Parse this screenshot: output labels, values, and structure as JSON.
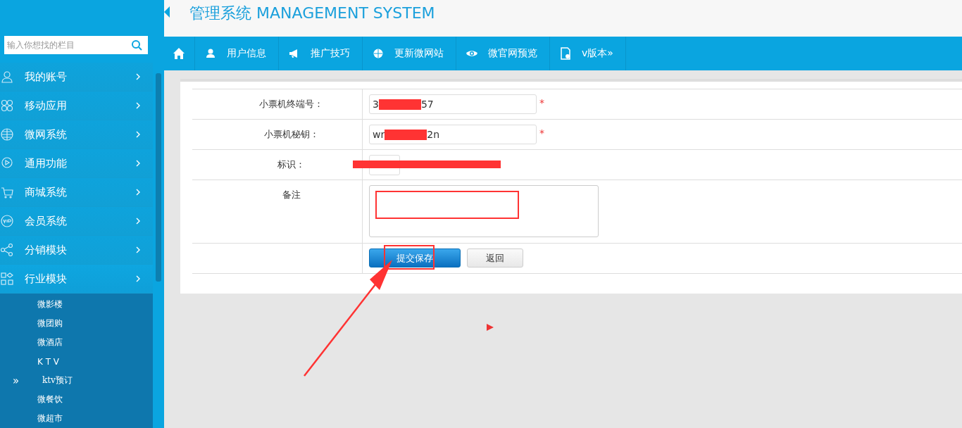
{
  "header": {
    "title": "管理系统 MANAGEMENT SYSTEM"
  },
  "search": {
    "placeholder": "输入你想找的栏目"
  },
  "sidebar": {
    "items": [
      {
        "label": "我的账号"
      },
      {
        "label": "移动应用"
      },
      {
        "label": "微网系统"
      },
      {
        "label": "通用功能"
      },
      {
        "label": "商城系统"
      },
      {
        "label": "会员系统"
      },
      {
        "label": "分销模块"
      },
      {
        "label": "行业模块",
        "expanded": true,
        "children": [
          {
            "label": "微影楼",
            "selected": false
          },
          {
            "label": "微团购",
            "selected": false
          },
          {
            "label": "微酒店",
            "selected": false
          },
          {
            "label": "K T V",
            "selected": false
          },
          {
            "label": "ktv预订",
            "selected": true,
            "marker": "»"
          },
          {
            "label": "微餐饮",
            "selected": false
          },
          {
            "label": "微超市",
            "selected": false
          }
        ]
      }
    ]
  },
  "nav": [
    {
      "kind": "icon"
    },
    {
      "kind": "link",
      "label": "用户信息"
    },
    {
      "kind": "link",
      "label": "推广技巧"
    },
    {
      "kind": "link",
      "label": "更新微网站"
    },
    {
      "kind": "link",
      "label": "微官网预览"
    },
    {
      "kind": "link",
      "label": "v版本»"
    }
  ],
  "form": {
    "rows": [
      {
        "kind": "text",
        "label": "小票机终端号：",
        "value_start": "3",
        "value_end": "57",
        "required_mark": "*"
      },
      {
        "kind": "text",
        "label": "小票机秘钥：",
        "value_start": "wr",
        "value_end": "2n",
        "required_mark": "*"
      },
      {
        "kind": "small",
        "label": "标识："
      },
      {
        "kind": "textarea",
        "label": "备注"
      },
      {
        "kind": "buttons",
        "buttons": [
          {
            "label": "提交保存",
            "kind": "primary"
          },
          {
            "label": "返回",
            "kind": "default"
          }
        ]
      }
    ]
  }
}
